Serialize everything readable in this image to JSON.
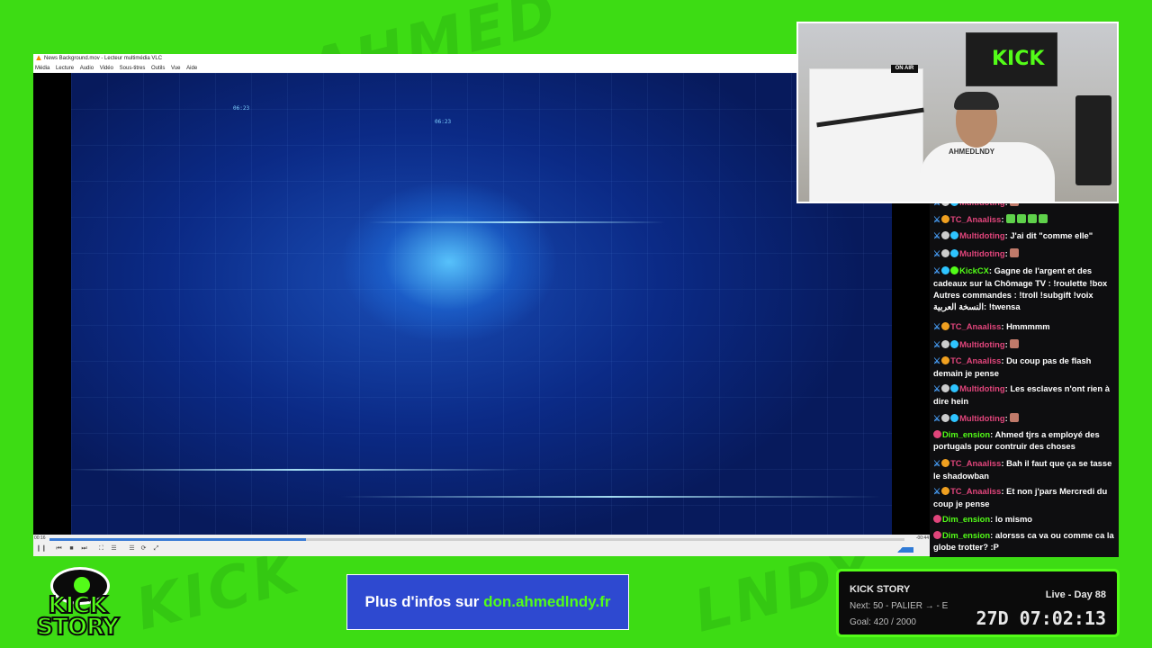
{
  "vlc": {
    "title": "News Background.mov - Lecteur multimédia VLC",
    "menu": [
      "Média",
      "Lecture",
      "Audio",
      "Vidéo",
      "Sous-titres",
      "Outils",
      "Vue",
      "Aide"
    ],
    "video_times": [
      "06:23",
      "06:23"
    ],
    "elapsed": "00:16",
    "remaining": "-00:44",
    "progress_fraction": 0.3,
    "volume": "70%"
  },
  "webcam": {
    "poster_text": "KICK",
    "on_air": "ON AIR",
    "shirt_text": "AHMEDLNDY"
  },
  "chat": {
    "messages": [
      {
        "user": "Multidoting",
        "user_color": "#e0457b",
        "badges": [
          "sword",
          "info",
          "cube"
        ],
        "text": "",
        "emote": true
      },
      {
        "user": "TC_Anaaliss",
        "user_color": "#e0457b",
        "badges": [
          "sword",
          "sub"
        ],
        "text": "",
        "emote_row": 4
      },
      {
        "user": "Multidoting",
        "user_color": "#e0457b",
        "badges": [
          "sword",
          "info",
          "cube"
        ],
        "text": "J'ai dit \"comme elle\""
      },
      {
        "user": "Multidoting",
        "user_color": "#e0457b",
        "badges": [
          "sword",
          "info",
          "cube"
        ],
        "text": "",
        "emote": true
      },
      {
        "user": "KickCX",
        "user_color": "#53fc18",
        "badges": [
          "sword",
          "cube",
          "verified"
        ],
        "text": "Gagne de l'argent et des cadeaux sur la Chômage TV : !roulette !box  Autres commandes : !troll !subgift !voix  النسخة العربية: !twensa"
      },
      {
        "user": "TC_Anaaliss",
        "user_color": "#e0457b",
        "badges": [
          "sword",
          "sub"
        ],
        "text": "Hmmmmm"
      },
      {
        "user": "Multidoting",
        "user_color": "#e0457b",
        "badges": [
          "sword",
          "info",
          "cube"
        ],
        "text": "",
        "emote": true
      },
      {
        "user": "TC_Anaaliss",
        "user_color": "#e0457b",
        "badges": [
          "sword",
          "sub"
        ],
        "text": "Du coup pas de flash demain je pense"
      },
      {
        "user": "Multidoting",
        "user_color": "#e0457b",
        "badges": [
          "sword",
          "info",
          "cube"
        ],
        "text": "Les esclaves n'ont rien à dire hein"
      },
      {
        "user": "Multidoting",
        "user_color": "#e0457b",
        "badges": [
          "sword",
          "info",
          "cube"
        ],
        "text": "",
        "emote": true
      },
      {
        "user": "Dim_ension",
        "user_color": "#53fc18",
        "badges": [
          "red"
        ],
        "text": "Ahmed tjrs a employé des portugals pour contruir des choses"
      },
      {
        "user": "TC_Anaaliss",
        "user_color": "#e0457b",
        "badges": [
          "sword",
          "sub"
        ],
        "text": "Bah il faut que ça se tasse le shadowban"
      },
      {
        "user": "TC_Anaaliss",
        "user_color": "#e0457b",
        "badges": [
          "sword",
          "sub"
        ],
        "text": "Et non j'pars Mercredi du coup je pense"
      },
      {
        "user": "Dim_ension",
        "user_color": "#53fc18",
        "badges": [
          "red"
        ],
        "text": "lo mismo"
      },
      {
        "user": "Dim_ension",
        "user_color": "#53fc18",
        "badges": [
          "red"
        ],
        "text": "alorsss ca va ou comme ca la globe trotter? :P"
      }
    ]
  },
  "logo": {
    "line1": "KICK",
    "line2": "STORY"
  },
  "banner": {
    "prefix": "Plus d'infos sur ",
    "url": "don.ahmedlndy.fr"
  },
  "panel": {
    "title": "KICK STORY",
    "next": "Next: 50 - PALIER → - E",
    "goal": "Goal: 420 / 2000",
    "live": "Live - Day 88",
    "clock": "27D 07:02:13"
  },
  "colors": {
    "green": "#3ddc14",
    "kick_green": "#53fc18",
    "banner_blue": "#2e49d0"
  }
}
